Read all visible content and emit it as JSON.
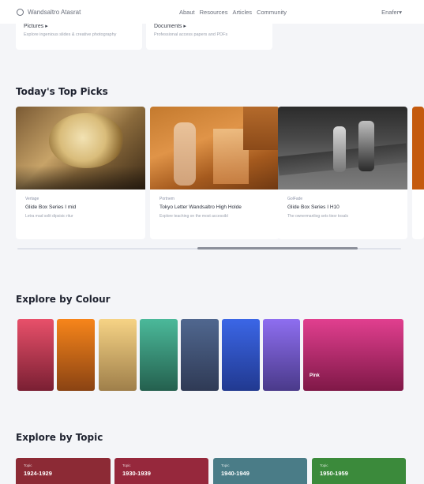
{
  "header": {
    "logo_text": "Wandsaltro Atasrat",
    "nav": [
      "Abaut",
      "Resources",
      "Articles",
      "Community"
    ],
    "language": "Enafer"
  },
  "doc_cards": [
    {
      "title": "Pictures",
      "desc": "Explore ingenious slides & creative photography"
    },
    {
      "title": "Documents",
      "desc": "Professional access papers and PDFs"
    }
  ],
  "top_picks": {
    "title": "Today's Top Picks",
    "items": [
      {
        "tag": "Vertage",
        "title": "Glide Box Series I mid",
        "desc": "Letra mad solit dipsisic ritur"
      },
      {
        "tag": "Portnem",
        "title": "Tokyo Letter Wandsaltro High Holde",
        "desc": "Explore teaching on the most accessibl"
      },
      {
        "tag": "GolFade",
        "title": "Glide Box Series I H10",
        "desc": "The ownermanliog sets tiesr tosals"
      }
    ]
  },
  "explore_colour": {
    "title": "Explore by Colour",
    "swatches": [
      {
        "name": "red",
        "from": "#e8506a",
        "to": "#7a1f33"
      },
      {
        "name": "orange",
        "from": "#f7851a",
        "to": "#8a4313"
      },
      {
        "name": "yellow",
        "from": "#f6d385",
        "to": "#9f7f4a"
      },
      {
        "name": "green",
        "from": "#4bb99a",
        "to": "#24604e"
      },
      {
        "name": "slate",
        "from": "#50678f",
        "to": "#2f3a55"
      },
      {
        "name": "blue",
        "from": "#3b66e6",
        "to": "#213990"
      },
      {
        "name": "purple",
        "from": "#8e6ef0",
        "to": "#4a3a8a"
      },
      {
        "name": "pink",
        "label": "Pink",
        "from": "#e13f8f",
        "to": "#7f1847"
      }
    ]
  },
  "explore_topic": {
    "title": "Explore by Topic",
    "tiles": [
      {
        "label": "Topic",
        "years": "1924-1929",
        "color": "#8c2a35"
      },
      {
        "label": "Topic",
        "years": "1930-1939",
        "color": "#96283c"
      },
      {
        "label": "Topic",
        "years": "1940-1949",
        "color": "#4a7c87"
      },
      {
        "label": "Topic",
        "years": "1950-1959",
        "color": "#3b8a3b"
      }
    ]
  },
  "colors": {
    "bg": "#f4f5f8",
    "card": "#ffffff",
    "title": "#1f2330"
  }
}
